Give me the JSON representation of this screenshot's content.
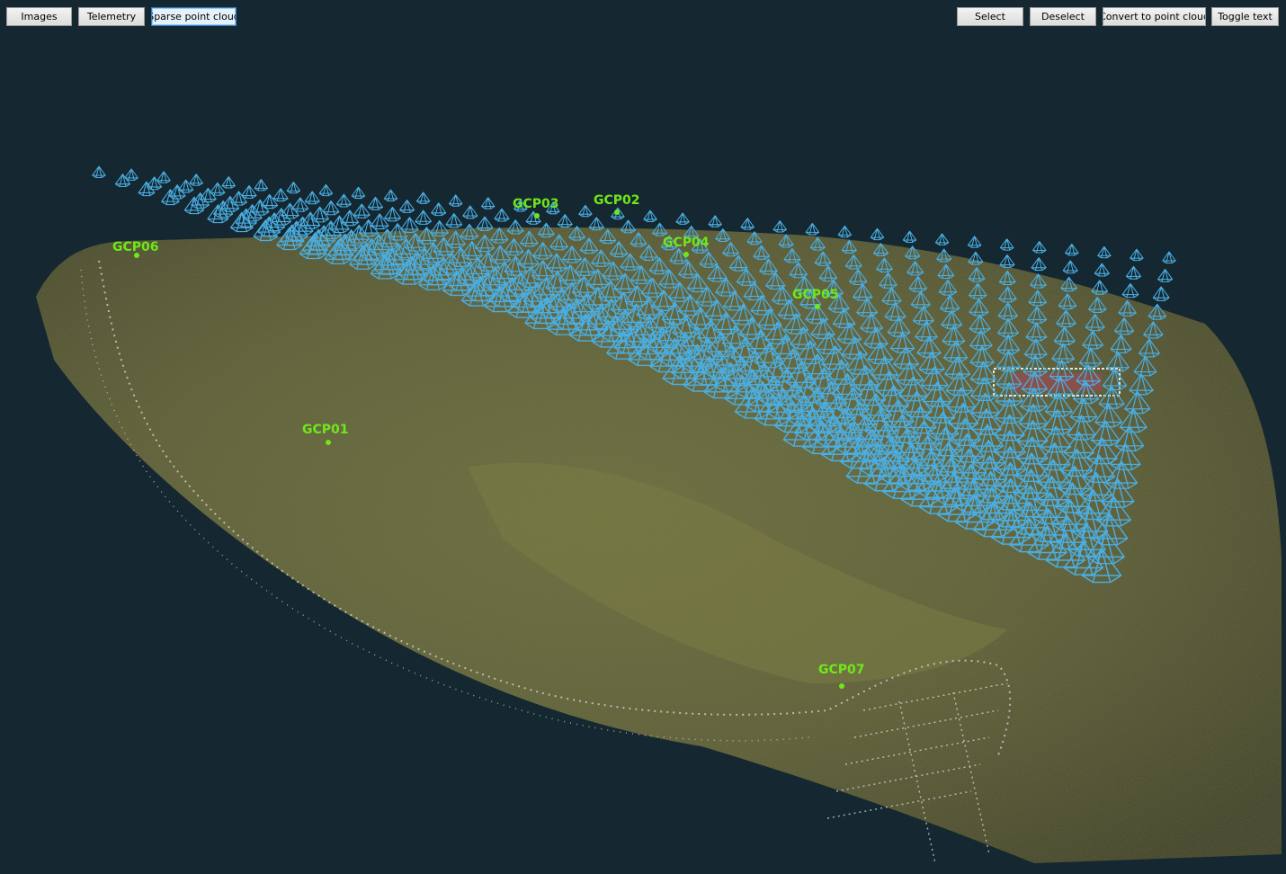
{
  "toolbar": {
    "left": [
      {
        "id": "images",
        "label": "Images"
      },
      {
        "id": "telemetry",
        "label": "Telemetry"
      },
      {
        "id": "sparse",
        "label": "Sparse point cloud",
        "active": true
      }
    ],
    "right": [
      {
        "id": "select",
        "label": "Select"
      },
      {
        "id": "deselect",
        "label": "Deselect"
      },
      {
        "id": "convert",
        "label": "Convert to point cloud"
      },
      {
        "id": "toggle",
        "label": "Toggle text"
      }
    ]
  },
  "viewport": {
    "background": "#152730",
    "camera_color": "#4aaee2",
    "gcp_color": "#6fe71a",
    "gcps": [
      {
        "name": "GCP01"
      },
      {
        "name": "GCP02"
      },
      {
        "name": "GCP03"
      },
      {
        "name": "GCP04"
      },
      {
        "name": "GCP05"
      },
      {
        "name": "GCP06"
      },
      {
        "name": "GCP07"
      }
    ]
  }
}
